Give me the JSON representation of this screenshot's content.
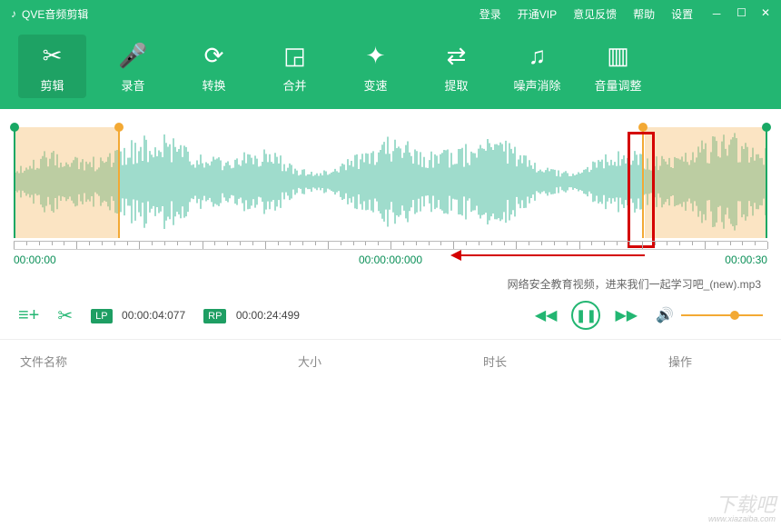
{
  "app": {
    "title": "QVE音频剪辑"
  },
  "menu": {
    "login": "登录",
    "vip": "开通VIP",
    "feedback": "意见反馈",
    "help": "帮助",
    "settings": "设置"
  },
  "tools": {
    "cut": "剪辑",
    "record": "录音",
    "convert": "转换",
    "merge": "合并",
    "speed": "变速",
    "extract": "提取",
    "denoise": "噪声消除",
    "volume": "音量调整"
  },
  "timeline": {
    "start": "00:00:00",
    "center": "00:00:00:000",
    "end": "00:00:30",
    "lp_label": "LP",
    "lp_time": "00:00:04:077",
    "rp_label": "RP",
    "rp_time": "00:00:24:499"
  },
  "file": {
    "current_name": "网络安全教育视频，进来我们一起学习吧_(new).mp3"
  },
  "table": {
    "name": "文件名称",
    "size": "大小",
    "duration": "时长",
    "action": "操作"
  },
  "watermark": {
    "big": "下载吧",
    "small": "www.xiazaiba.com"
  },
  "colors": {
    "primary": "#23b672",
    "accent": "#f3a934",
    "highlight_red": "#d40000"
  }
}
